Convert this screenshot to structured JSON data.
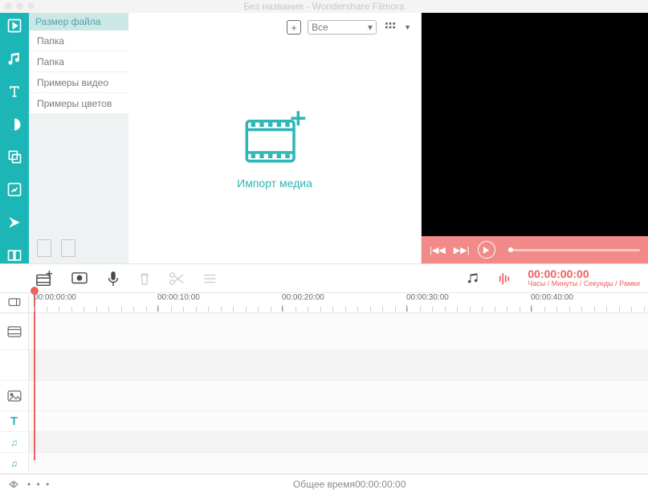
{
  "title": "Без названия - Wondershare Filmora",
  "browser": {
    "header": "Размер файла",
    "items": [
      "Папка",
      "Папка",
      "Примеры видео",
      "Примеры цветов"
    ]
  },
  "mediaToolbar": {
    "filter": "Все"
  },
  "import": {
    "label": "Импорт медиа"
  },
  "timecode": {
    "value": "00:00:00:00",
    "sub": "Часы / Минуты / Секунды / Рамки"
  },
  "ruler": {
    "t0": "00:00:00:00",
    "t1": "00:00:10:00",
    "t2": "00:00:20:00",
    "t3": "00:00:30:00",
    "t4": "00:00:40:00"
  },
  "status": {
    "totalLabel": "Общее время",
    "totalValue": "00:00:00:00"
  }
}
